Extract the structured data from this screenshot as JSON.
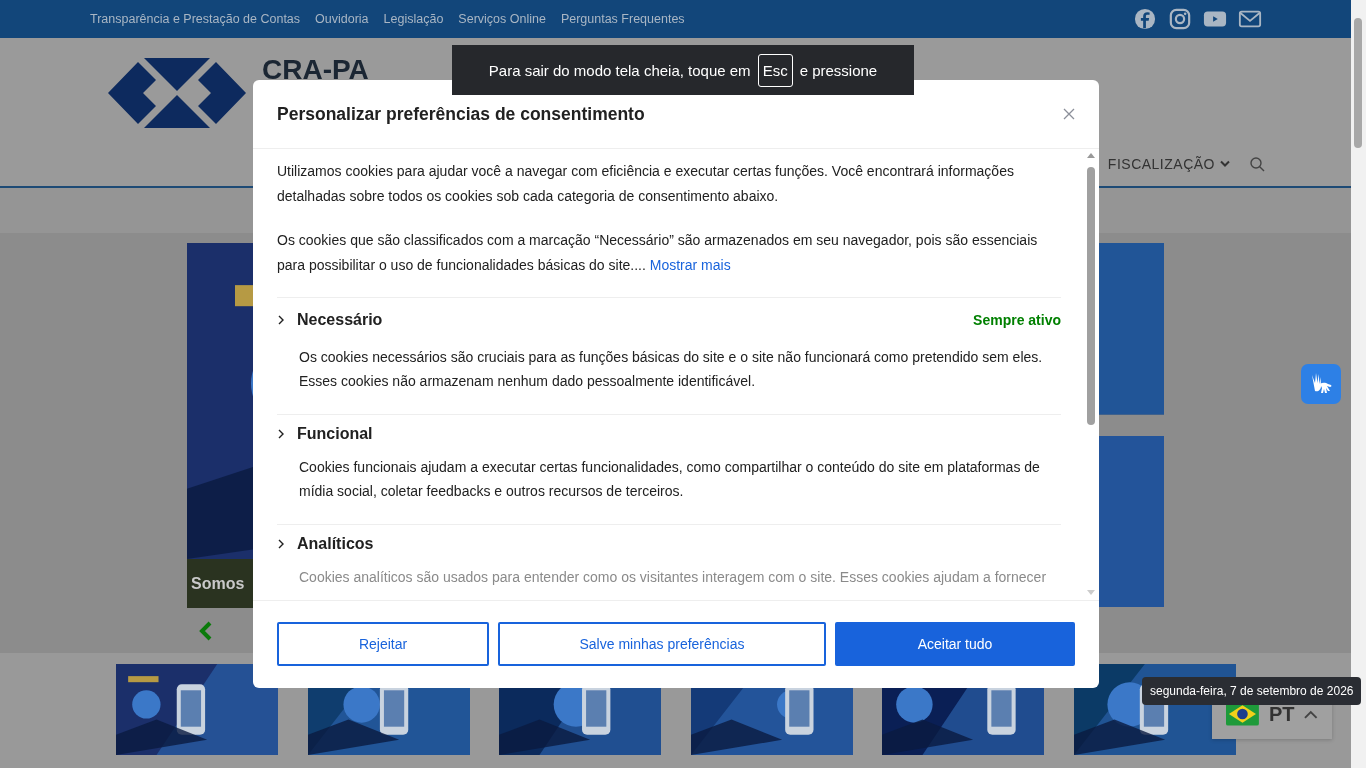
{
  "top_bar": {
    "links": [
      "Transparência e Prestação de Contas",
      "Ouvidoria",
      "Legislação",
      "Serviços Online",
      "Perguntas Frequentes"
    ]
  },
  "header": {
    "logo_text": "CRA-PA",
    "nav": [
      {
        "label": "FISCALIZAÇÃO",
        "has_dropdown": true
      }
    ]
  },
  "slider": {
    "caption": "Somos"
  },
  "fullscreen_notice": {
    "before": "Para sair do modo tela cheia, toque em",
    "key": "Esc",
    "after": "e pressione"
  },
  "consent_modal": {
    "title": "Personalizar preferências de consentimento",
    "intro": [
      "Utilizamos cookies para ajudar você a navegar com eficiência e executar certas funções. Você encontrará informações detalhadas sobre todos os cookies sob cada categoria de consentimento abaixo.",
      "Os cookies que são classificados com a marcação “Necessário” são armazenados em seu navegador, pois são essenciais para possibilitar o uso de funcionalidades básicas do site.... "
    ],
    "show_more": "Mostrar mais",
    "categories": [
      {
        "name": "Necessário",
        "expanded": false,
        "status": "Sempre ativo",
        "description": "Os cookies necessários são cruciais para as funções básicas do site e o site não funcionará como pretendido sem eles. Esses cookies não armazenam nenhum dado pessoalmente identificável."
      },
      {
        "name": "Funcional",
        "expanded": false,
        "description": "Cookies funcionais ajudam a executar certas funcionalidades, como compartilhar o conteúdo do site em plataformas de mídia social, coletar feedbacks e outros recursos de terceiros."
      },
      {
        "name": "Analíticos",
        "expanded": false,
        "description": "Cookies analíticos são usados para entender como os visitantes interagem com o site. Esses cookies ajudam a fornecer"
      }
    ],
    "buttons": [
      {
        "label": "Rejeitar",
        "kind": "outline"
      },
      {
        "label": "Salve minhas preferências",
        "kind": "outline"
      },
      {
        "label": "Aceitar tudo",
        "kind": "primary"
      }
    ]
  },
  "date_tooltip": "segunda-feira, 7 de setembro de 2026",
  "language": {
    "code": "PT"
  }
}
